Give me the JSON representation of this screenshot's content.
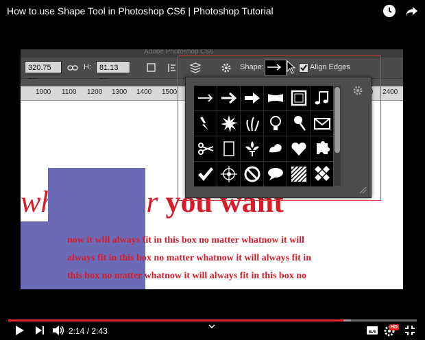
{
  "player": {
    "title": "How to use Shape Tool in Photoshop CS6 | Photoshop Tutorial",
    "time_current": "2:14",
    "time_separator": "/",
    "time_total": "2:43",
    "progress": 0.82,
    "accent_color": "#e22222",
    "controls": [
      "play-icon",
      "next-icon",
      "volume-icon",
      "chevron-down-icon",
      "subtitles-icon",
      "settings-icon",
      "fullscreen-exit-icon"
    ],
    "hd_badge": "HD"
  },
  "photoshop": {
    "window_title": "Adobe Photoshop CS6",
    "options_bar": {
      "width_value": "320.75 px",
      "height_label": "H:",
      "height_value": "81.13 px",
      "shape_label": "Shape:",
      "align_edges_label": "Align Edges",
      "align_edges_checked": true
    },
    "ruler_ticks": [
      "1000",
      "1100",
      "1200",
      "1300",
      "1400",
      "1500",
      "2300",
      "2400"
    ],
    "canvas": {
      "big_text_italic": "wh",
      "big_text_italic2": "r",
      "big_text": "you want",
      "para_lines": [
        "now it will always fit in this box no matter whatnow it will",
        "always fit in this box no matter whatnow it will always fit in",
        "this box no matter whatnow it will always fit in this box no"
      ],
      "text_color": "#d61d2b",
      "shape_color": "#6a6ab6"
    },
    "shape_picker": {
      "shapes": [
        "arrow-thin-icon",
        "arrow-medium-icon",
        "arrow-bold-icon",
        "banner-icon",
        "frame-icon",
        "music-note-icon",
        "lightning-icon",
        "starburst-icon",
        "grass-icon",
        "lightbulb-icon",
        "pushpin-icon",
        "envelope-icon",
        "scissors-icon",
        "blank-frame-icon",
        "fleur-de-lis-icon",
        "ornament-icon",
        "heart-icon",
        "puzzle-icon",
        "checkmark-icon",
        "target-icon",
        "no-sign-icon",
        "speech-bubble-icon",
        "hatch-grid-icon",
        "checker-grid-icon"
      ]
    }
  }
}
